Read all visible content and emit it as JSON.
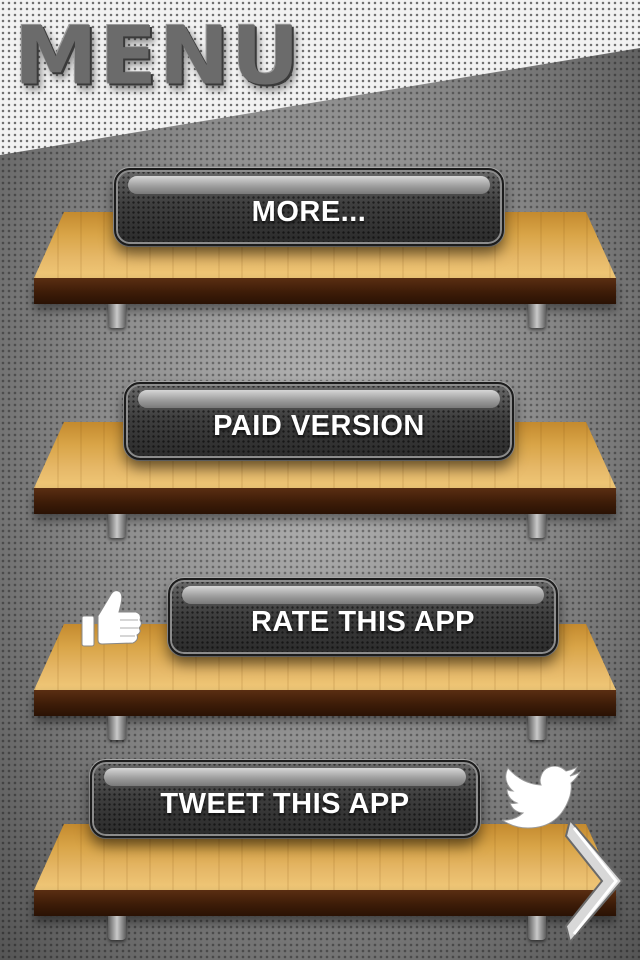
{
  "header": {
    "title": "MENU"
  },
  "menu": {
    "items": [
      {
        "label": "MORE..."
      },
      {
        "label": "PAID VERSION"
      },
      {
        "label": "RATE THIS APP"
      },
      {
        "label": "TWEET THIS APP"
      }
    ]
  },
  "icons": {
    "rate": "thumbs-up-icon",
    "tweet": "twitter-bird-icon",
    "next": "chevron-right-icon"
  },
  "colors": {
    "button": "#3b3b3b",
    "shelf_wood": "#d9a548",
    "shelf_front": "#3d1c08",
    "title": "#6b6b6b"
  }
}
